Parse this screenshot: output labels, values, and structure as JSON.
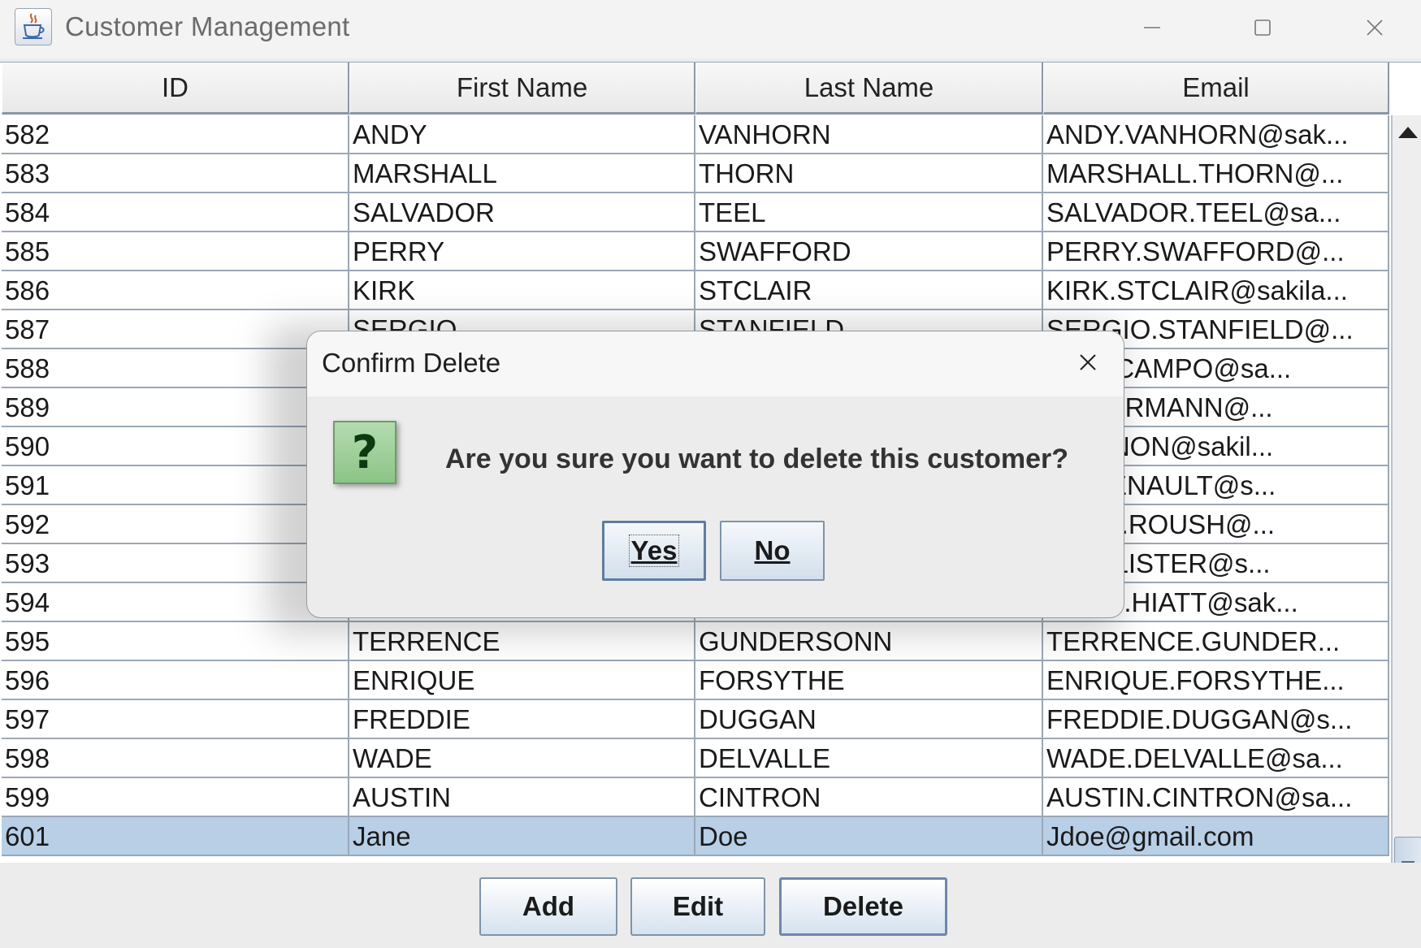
{
  "window": {
    "title": "Customer Management",
    "icon": "java-cup-icon",
    "controls": [
      "minimize-icon",
      "maximize-icon",
      "close-icon"
    ]
  },
  "table": {
    "columns": [
      "ID",
      "First Name",
      "Last Name",
      "Email"
    ],
    "rows": [
      [
        "582",
        "ANDY",
        "VANHORN",
        "ANDY.VANHORN@sak..."
      ],
      [
        "583",
        "MARSHALL",
        "THORN",
        "MARSHALL.THORN@..."
      ],
      [
        "584",
        "SALVADOR",
        "TEEL",
        "SALVADOR.TEEL@sa..."
      ],
      [
        "585",
        "PERRY",
        "SWAFFORD",
        "PERRY.SWAFFORD@..."
      ],
      [
        "586",
        "KIRK",
        "STCLAIR",
        "KIRK.STCLAIR@sakila..."
      ],
      [
        "587",
        "SERGIO",
        "STANFIELD",
        "SERGIO.STANFIELD@..."
      ],
      [
        "588",
        "",
        "",
        "ON.OCAMPO@sa..."
      ],
      [
        "589",
        "",
        "",
        "Y.HERRMANN@..."
      ],
      [
        "590",
        "",
        "",
        ".HANNON@sakil..."
      ],
      [
        "591",
        "",
        "",
        ".ARSENAULT@s..."
      ],
      [
        "592",
        "",
        "",
        "ANCE.ROUSH@..."
      ],
      [
        "593",
        "",
        "",
        ".MCALISTER@s..."
      ],
      [
        "594",
        "",
        "",
        "ARDO.HIATT@sak..."
      ],
      [
        "595",
        "TERRENCE",
        "GUNDERSONN",
        "TERRENCE.GUNDER..."
      ],
      [
        "596",
        "ENRIQUE",
        "FORSYTHE",
        "ENRIQUE.FORSYTHE..."
      ],
      [
        "597",
        "FREDDIE",
        "DUGGAN",
        "FREDDIE.DUGGAN@s..."
      ],
      [
        "598",
        "WADE",
        "DELVALLE",
        "WADE.DELVALLE@sa..."
      ],
      [
        "599",
        "AUSTIN",
        "CINTRON",
        "AUSTIN.CINTRON@sa..."
      ],
      [
        "601",
        "Jane",
        "Doe",
        "Jdoe@gmail.com"
      ]
    ],
    "selected_row_index": 18
  },
  "buttons": {
    "add": "Add",
    "edit": "Edit",
    "delete": "Delete"
  },
  "dialog": {
    "title": "Confirm Delete",
    "message": "Are you sure you want to delete this customer?",
    "icon": "question-icon",
    "icon_glyph": "?",
    "yes": "Yes",
    "no": "No"
  },
  "colors": {
    "selected_row": "#b8cfe6",
    "grid_line": "#9aa8b8",
    "question_icon": "#9fd09a"
  }
}
